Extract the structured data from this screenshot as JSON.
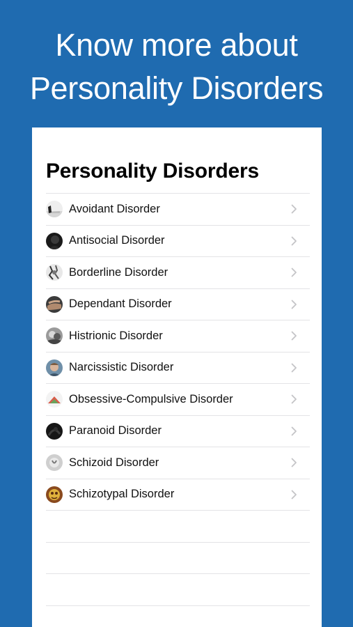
{
  "promo": {
    "line1": "Know more about",
    "line2": "Personality Disorders"
  },
  "screen": {
    "title": "Personality Disorders"
  },
  "items": [
    {
      "label": "Avoidant Disorder",
      "icon": "avoidant-thumbnail-icon"
    },
    {
      "label": "Antisocial Disorder",
      "icon": "antisocial-thumbnail-icon"
    },
    {
      "label": "Borderline Disorder",
      "icon": "borderline-thumbnail-icon"
    },
    {
      "label": "Dependant Disorder",
      "icon": "dependant-thumbnail-icon"
    },
    {
      "label": "Histrionic Disorder",
      "icon": "histrionic-thumbnail-icon"
    },
    {
      "label": "Narcissistic Disorder",
      "icon": "narcissistic-thumbnail-icon"
    },
    {
      "label": "Obsessive-Compulsive Disorder",
      "icon": "obsessive-compulsive-thumbnail-icon"
    },
    {
      "label": "Paranoid Disorder",
      "icon": "paranoid-thumbnail-icon"
    },
    {
      "label": "Schizoid Disorder",
      "icon": "schizoid-thumbnail-icon"
    },
    {
      "label": "Schizotypal Disorder",
      "icon": "schizotypal-thumbnail-icon"
    }
  ],
  "colors": {
    "background": "#1F6BB0",
    "card": "#FFFFFF",
    "separator": "#E3E3E6",
    "chevron": "#C4C4C7"
  }
}
